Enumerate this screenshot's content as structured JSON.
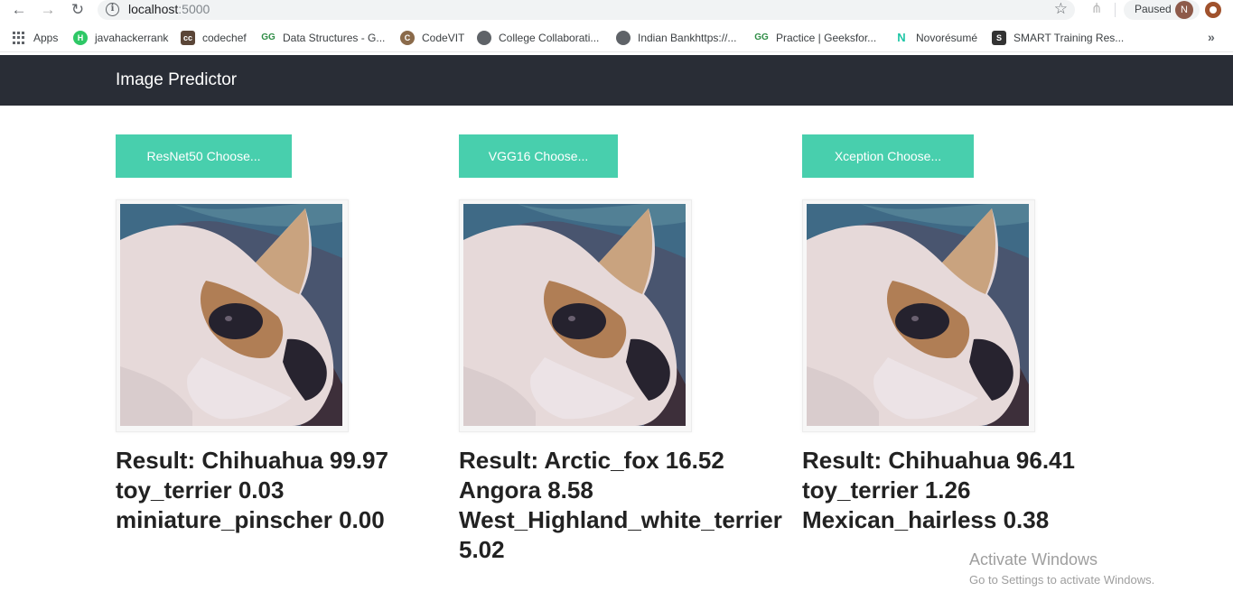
{
  "browser": {
    "url_host": "localhost",
    "url_port": ":5000",
    "profile_label": "Paused",
    "profile_initial": "N",
    "bookmarks": [
      {
        "label": "Apps",
        "icon": "apps-grid-icon"
      },
      {
        "label": "javahackerrank",
        "icon": "hackerrank-icon",
        "color": "#2ec866"
      },
      {
        "label": "codechef",
        "icon": "codechef-icon",
        "color": "#5b4638"
      },
      {
        "label": "Data Structures - G...",
        "icon": "geeksforgeeks-icon",
        "color": "#2f8d46"
      },
      {
        "label": "CodeVIT",
        "icon": "codevit-icon",
        "color": "#8a6a4a"
      },
      {
        "label": "College Collaborati...",
        "icon": "globe-icon",
        "color": "#5f6368"
      },
      {
        "label": "Indian Bankhttps://...",
        "icon": "globe-icon",
        "color": "#5f6368"
      },
      {
        "label": "Practice | Geeksfor...",
        "icon": "geeksforgeeks-icon",
        "color": "#2f8d46"
      },
      {
        "label": "Novorésumé",
        "icon": "novoresume-icon",
        "color": "#1fc6a6"
      },
      {
        "label": "SMART Training Res...",
        "icon": "smart-icon",
        "color": "#333333"
      }
    ]
  },
  "app": {
    "title": "Image Predictor",
    "accent_color": "#48cfad",
    "navbar_color": "#292d36"
  },
  "models": [
    {
      "button_label": "ResNet50 Choose...",
      "result_lines": [
        "Result: Chihuahua 99.97",
        "toy_terrier 0.03",
        "miniature_pinscher 0.00"
      ]
    },
    {
      "button_label": "VGG16 Choose...",
      "result_lines": [
        "Result: Arctic_fox 16.52",
        "Angora 8.58",
        "West_Highland_white_terrier 5.02"
      ]
    },
    {
      "button_label": "Xception Choose...",
      "result_lines": [
        "Result: Chihuahua 96.41",
        "toy_terrier 1.26",
        "Mexican_hairless 0.38"
      ]
    }
  ],
  "watermark": {
    "line1": "Activate Windows",
    "line2": "Go to Settings to activate Windows."
  }
}
